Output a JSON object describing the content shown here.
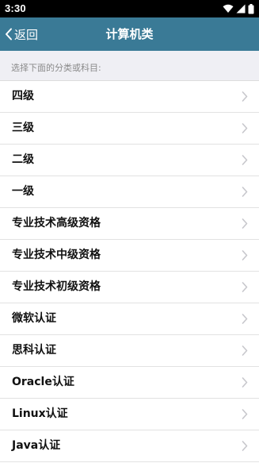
{
  "status_bar": {
    "time": "3:30",
    "icons": [
      "wifi-icon",
      "signal-icon",
      "battery-icon"
    ]
  },
  "nav": {
    "back_label": "返回",
    "title": "计算机类"
  },
  "section": {
    "label": "选择下面的分类或科目:"
  },
  "categories": [
    {
      "label": "四级"
    },
    {
      "label": "三级"
    },
    {
      "label": "二级"
    },
    {
      "label": "一级"
    },
    {
      "label": "专业技术高级资格"
    },
    {
      "label": "专业技术中级资格"
    },
    {
      "label": "专业技术初级资格"
    },
    {
      "label": "微软认证"
    },
    {
      "label": "思科认证"
    },
    {
      "label": "Oracle认证"
    },
    {
      "label": "Linux认证"
    },
    {
      "label": "Java认证"
    }
  ],
  "colors": {
    "nav_bar": "#3a7a96",
    "section_bg": "#efeff4",
    "chevron": "#c7c7cc"
  }
}
